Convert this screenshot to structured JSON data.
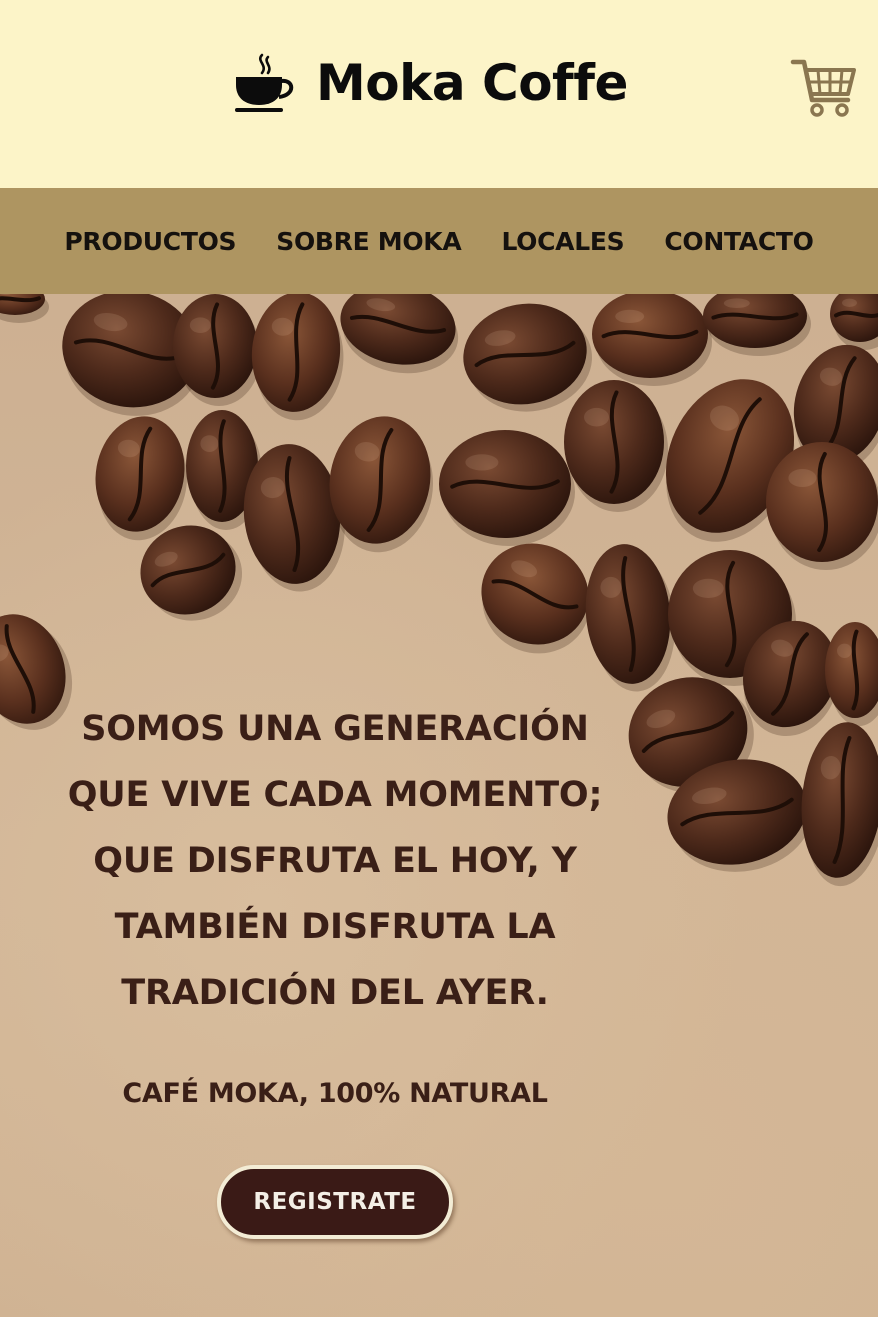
{
  "header": {
    "brand": "Moka Coffe",
    "logo_icon": "coffee-cup-icon",
    "cart_icon": "shopping-cart-icon",
    "background": "#fcf4c8"
  },
  "nav": {
    "background": "#ae9561",
    "items": [
      {
        "label": "PRODUCTOS"
      },
      {
        "label": "SOBRE MOKA"
      },
      {
        "label": "LOCALES"
      },
      {
        "label": "CONTACTO"
      }
    ]
  },
  "hero": {
    "background_image": "coffee-beans-on-paper",
    "tagline_lines": [
      "SOMOS UNA GENERACIÓN",
      "QUE VIVE CADA MOMENTO;",
      "QUE DISFRUTA EL HOY, Y",
      "TAMBIÉN DISFRUTA LA",
      "TRADICIÓN DEL AYER."
    ],
    "subtitle": "CAFÉ MOKA, 100% NATURAL",
    "button_label": "REGISTRATE",
    "text_color": "#3a1f17",
    "button_color": "#3a1a16"
  }
}
